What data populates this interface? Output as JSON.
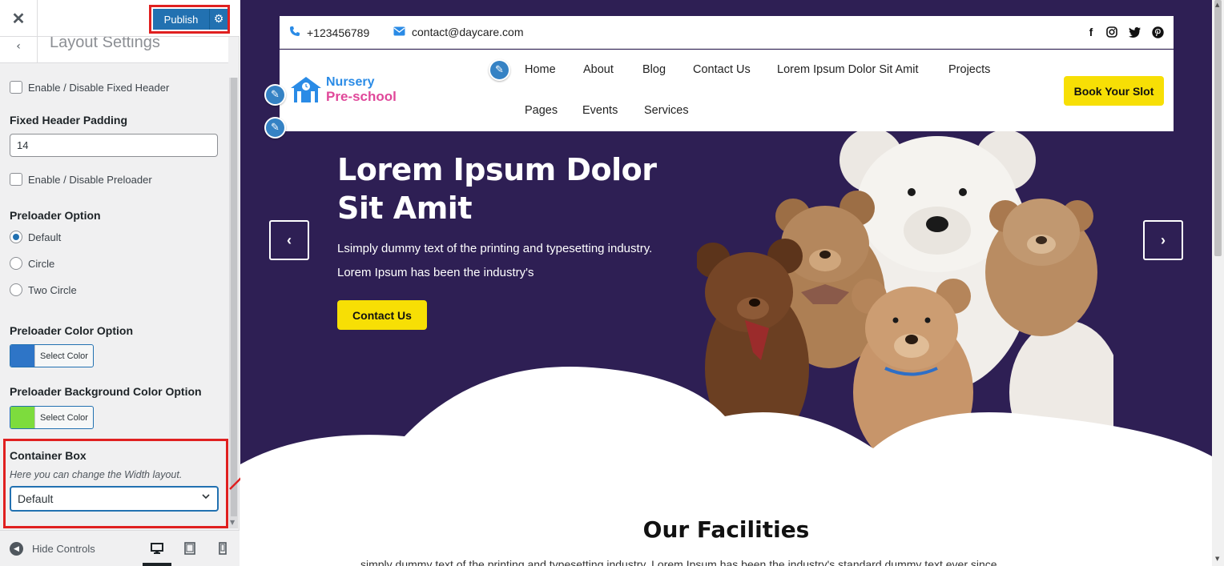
{
  "customizer": {
    "close_icon": "close-icon",
    "publish_label": "Publish",
    "section_title": "Layout Settings",
    "fixed_header_toggle": "Enable / Disable Fixed Header",
    "fixed_header_padding_title": "Fixed Header Padding",
    "fixed_header_padding_value": "14",
    "preloader_toggle": "Enable / Disable Preloader",
    "preloader_option_title": "Preloader Option",
    "preloader_options": [
      "Default",
      "Circle",
      "Two Circle"
    ],
    "preloader_selected": "Default",
    "preloader_color_title": "Preloader Color Option",
    "preloader_color": "#2e75c7",
    "preloader_bg_title": "Preloader Background Color Option",
    "preloader_bg_color": "#7ddc3d",
    "select_color_label": "Select Color",
    "container_box_title": "Container Box",
    "container_box_desc": "Here you can change the Width layout.",
    "container_box_value": "Default",
    "hide_controls_label": "Hide Controls",
    "devices": [
      "desktop",
      "tablet",
      "mobile"
    ]
  },
  "site": {
    "phone": "+123456789",
    "email": "contact@daycare.com",
    "social": [
      "f",
      "instagram",
      "twitter",
      "pinterest"
    ],
    "logo_line1": "Nursery",
    "logo_line2": "Pre-school",
    "nav": [
      "Home",
      "About",
      "Blog",
      "Contact Us",
      "Lorem Ipsum Dolor Sit Amit",
      "Projects",
      "Pages",
      "Events",
      "Services"
    ],
    "book_btn": "Book Your Slot",
    "hero_title": "Lorem Ipsum Dolor Sit Amit",
    "hero_line1": "Lsimply dummy text of the printing and typesetting industry.",
    "hero_line2": "Lorem Ipsum has been the industry's",
    "hero_cta": "Contact Us",
    "prev_arrow": "‹",
    "next_arrow": "›",
    "facilities_title": "Our Facilities",
    "facilities_text": "simply dummy text of the printing and typesetting industry. Lorem Ipsum has been the industry's standard dummy text ever since"
  },
  "colors": {
    "hero_bg": "#2e1f54",
    "accent_yellow": "#f7df05",
    "wp_blue": "#2271b1",
    "highlight_red": "#e02020"
  }
}
